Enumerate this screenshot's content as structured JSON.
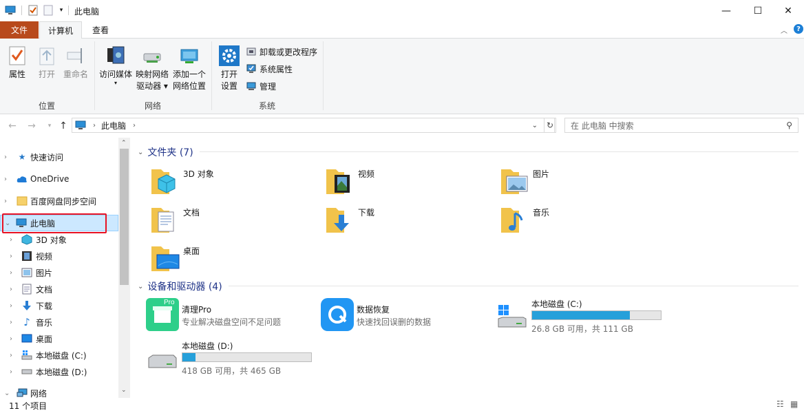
{
  "titlebar": {
    "title": "此电脑",
    "minimize": "—",
    "maximize": "☐",
    "close": "✕"
  },
  "tabs": {
    "file": "文件",
    "computer": "计算机",
    "view": "查看"
  },
  "ribbon": {
    "properties": "属性",
    "open": "打开",
    "rename": "重命名",
    "group_location": "位置",
    "access_media": "访问媒体",
    "map_drive_1": "映射网络",
    "map_drive_2": "驱动器",
    "add_location_1": "添加一个",
    "add_location_2": "网络位置",
    "group_network": "网络",
    "open_settings_1": "打开",
    "open_settings_2": "设置",
    "uninstall": "卸载或更改程序",
    "system_props": "系统属性",
    "manage": "管理",
    "group_system": "系统"
  },
  "address": {
    "path": "此电脑",
    "search_placeholder": "在 此电脑 中搜索"
  },
  "nav": {
    "quick_access": "快速访问",
    "onedrive": "OneDrive",
    "baidu": "百度网盘同步空间",
    "this_pc": "此电脑",
    "objects3d": "3D 对象",
    "videos": "视频",
    "pictures": "图片",
    "documents": "文档",
    "downloads": "下载",
    "music": "音乐",
    "desktop": "桌面",
    "disk_c": "本地磁盘 (C:)",
    "disk_d": "本地磁盘 (D:)",
    "network": "网络"
  },
  "content": {
    "folders_header": "文件夹 (7)",
    "folders": [
      "3D 对象",
      "视频",
      "图片",
      "文档",
      "下载",
      "音乐",
      "桌面"
    ],
    "devices_header": "设备和驱动器 (4)",
    "devices": [
      {
        "name": "清理Pro",
        "sub": "专业解决磁盘空间不足问题",
        "badge": "Pro"
      },
      {
        "name": "数据恢复",
        "sub": "快速找回误删的数据"
      },
      {
        "name": "本地磁盘 (C:)",
        "sub": "26.8 GB 可用，共 111 GB",
        "used_fraction": 0.76
      },
      {
        "name": "本地磁盘 (D:)",
        "sub": "418 GB 可用，共 465 GB",
        "used_fraction": 0.1
      }
    ]
  },
  "status": {
    "items": "11 个项目"
  },
  "colors": {
    "file_tab": "#b84a1c",
    "accent": "#26a0da",
    "header": "#1e3287",
    "selection": "#cce8ff",
    "highlight_box": "#e81123"
  }
}
